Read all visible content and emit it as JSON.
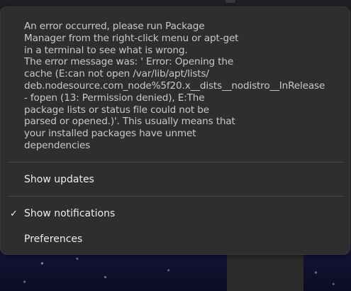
{
  "menu": {
    "error_message": "An error occurred, please run Package\nManager from the right-click menu or apt-get\nin a terminal to see what is wrong.\nThe error message was: ' Error: Opening the\ncache (E:can not open /var/lib/apt/lists/\ndeb.nodesource.com_node%5f20.x__dists__nodistro__InRelease\n- fopen (13: Permission denied), E:The\npackage lists or status file could not be\nparsed or opened.)'. This usually means that\nyour installed packages have unmet\ndependencies",
    "items": [
      {
        "label": "Show updates",
        "checked": false
      },
      {
        "label": "Show notifications",
        "checked": true,
        "check_glyph": "✓"
      },
      {
        "label": "Preferences",
        "checked": false
      }
    ]
  },
  "colors": {
    "menu_background": "#2e2e30",
    "text_muted": "#c9c9c9",
    "text_primary": "#ededed",
    "separator": "#454547"
  },
  "icons": {
    "checkmark": "checkmark-icon"
  }
}
